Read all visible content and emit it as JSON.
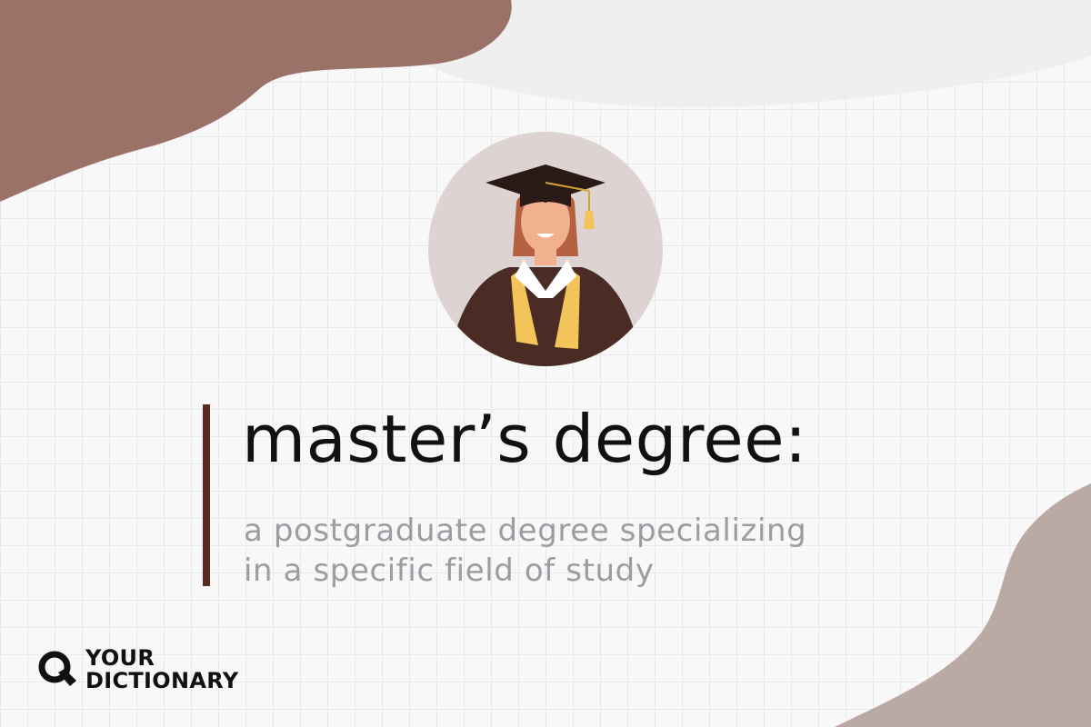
{
  "term": {
    "title": "master’s degree:",
    "definition_lines": [
      "a postgraduate degree specializing",
      "in a specific field of study"
    ]
  },
  "brand": {
    "line1": "YOUR",
    "line2": "DICTIONARY",
    "logo_icon": "magnifier-q-icon"
  },
  "illustration": {
    "icon": "graduate-avatar-icon"
  },
  "colors": {
    "background": "#f8f8f8",
    "grid": "#e6e9ec",
    "blob_brown": "#9a7268",
    "blob_taupe": "#bba9a4",
    "blob_light": "#ededed",
    "avatar_circle": "#ddd3d2",
    "accent_bar": "#5a2a1c",
    "title_text": "#111111",
    "definition_text": "#9c9da2",
    "brand_text": "#111111",
    "gown": "#4a2c24",
    "stole": "#f2c45a",
    "skin": "#f2b18e",
    "hair": "#b5603e",
    "cap": "#2a1a15"
  }
}
